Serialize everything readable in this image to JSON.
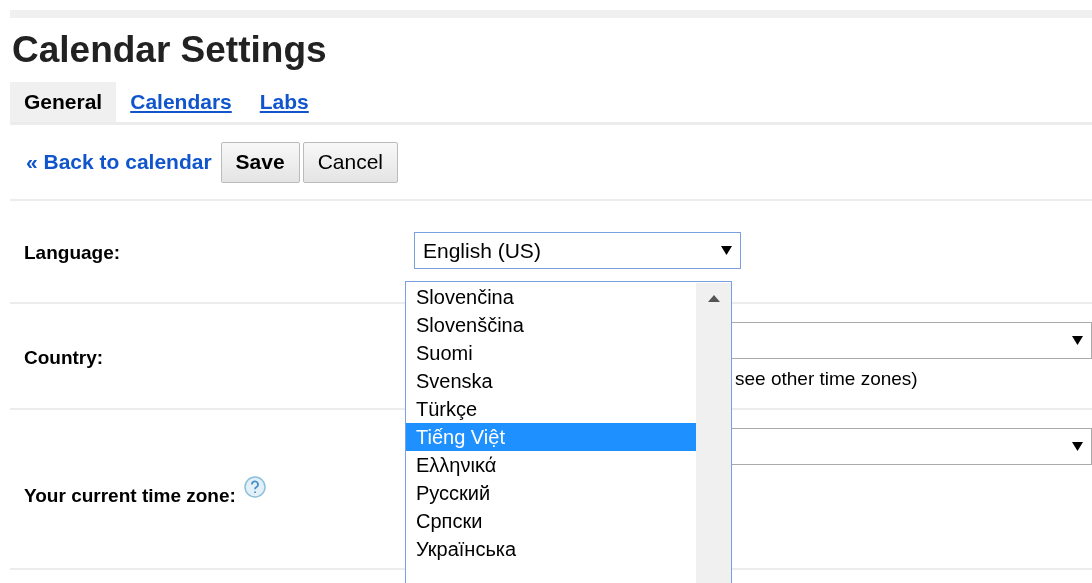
{
  "title": "Calendar Settings",
  "tabs": [
    {
      "label": "General",
      "selected": true
    },
    {
      "label": "Calendars",
      "selected": false
    },
    {
      "label": "Labs",
      "selected": false
    }
  ],
  "toolbar": {
    "back_link": "« Back to calendar",
    "buttons": [
      {
        "label": "Save",
        "kind": "primary"
      },
      {
        "label": "Cancel",
        "kind": "secondary"
      }
    ]
  },
  "settings": [
    {
      "label": "Language:",
      "kind": "language",
      "value": "English (US)"
    },
    {
      "label": "Country:",
      "kind": "country",
      "note": "see other time zones)"
    },
    {
      "label": "Your current time zone:",
      "kind": "timezone",
      "help": true
    }
  ],
  "language_options": [
    {
      "label": "Slovenčina",
      "selected": false
    },
    {
      "label": "Slovenščina",
      "selected": false
    },
    {
      "label": "Suomi",
      "selected": false
    },
    {
      "label": "Svenska",
      "selected": false
    },
    {
      "label": "Türkçe",
      "selected": false
    },
    {
      "label": "Tiếng Việt",
      "selected": true
    },
    {
      "label": "Ελληνικά",
      "selected": false
    },
    {
      "label": "Русский",
      "selected": false
    },
    {
      "label": "Српски",
      "selected": false
    },
    {
      "label": "Українська",
      "selected": false
    }
  ]
}
